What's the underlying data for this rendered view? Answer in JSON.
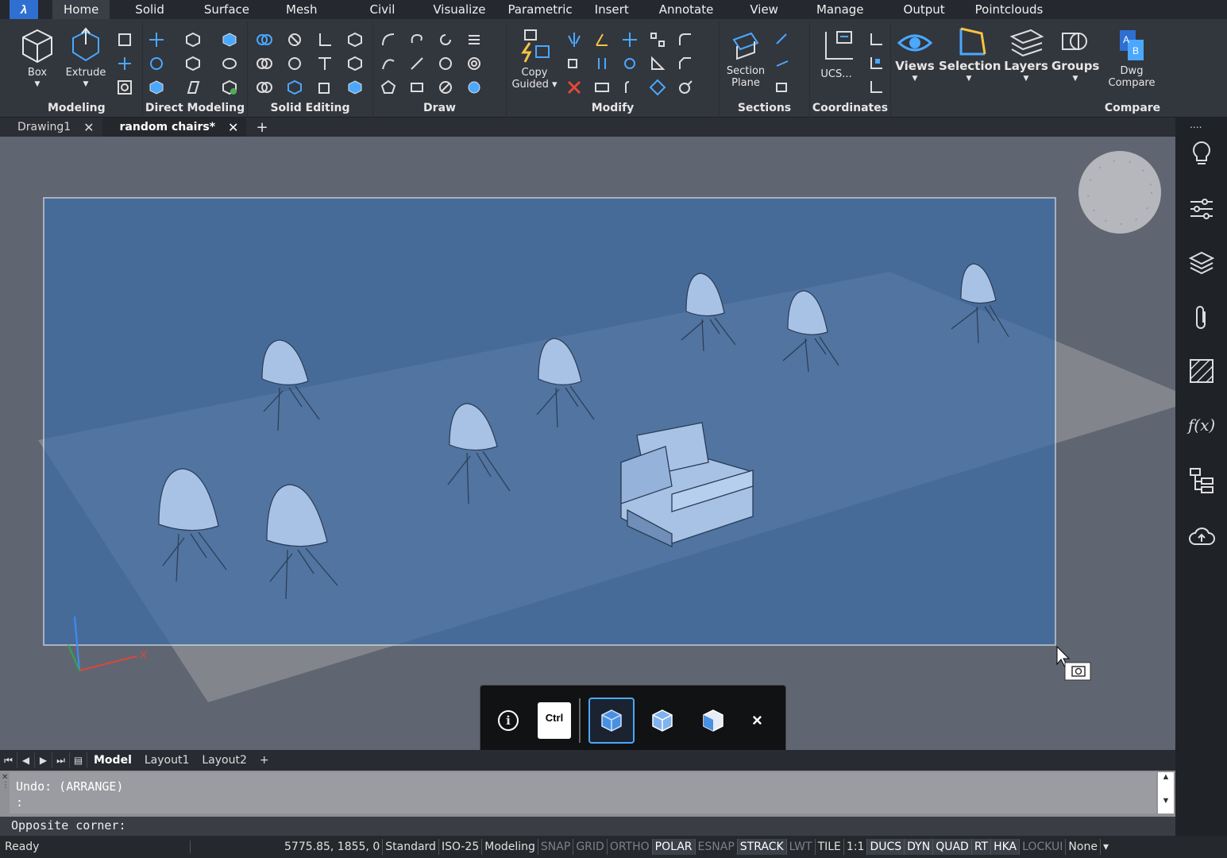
{
  "app": {
    "logo": "λ"
  },
  "menu": {
    "tabs": [
      "Home",
      "Solid",
      "Surface",
      "Mesh",
      "Civil",
      "Visualize",
      "Parametric",
      "Insert",
      "Annotate",
      "View",
      "Manage",
      "Output",
      "Pointclouds"
    ],
    "active": "Home"
  },
  "ribbon": {
    "panels": {
      "modeling": "Modeling",
      "direct_modeling": "Direct Modeling",
      "solid_editing": "Solid Editing",
      "draw": "Draw",
      "modify": "Modify",
      "sections": "Sections",
      "coordinates": "Coordinates",
      "compare": "Compare"
    },
    "buttons": {
      "box": "Box",
      "extrude": "Extrude",
      "copy_guided_1": "Copy",
      "copy_guided_2": "Guided",
      "section_plane_1": "Section",
      "section_plane_2": "Plane",
      "ucs": "UCS...",
      "views": "Views",
      "selection": "Selection",
      "layers": "Layers",
      "groups": "Groups",
      "dwg_compare_1": "Dwg",
      "dwg_compare_2": "Compare"
    }
  },
  "doc_tabs": [
    {
      "label": "Drawing1",
      "active": false
    },
    {
      "label": "random chairs*",
      "active": true
    }
  ],
  "doc_tabs_add": "+",
  "layout_tabs": {
    "model": "Model",
    "layout1": "Layout1",
    "layout2": "Layout2",
    "add": "+"
  },
  "command": {
    "history_line1": "Undo: (ARRANGE)",
    "history_line2": ":",
    "prompt": "Opposite corner:"
  },
  "float_toolbar": {
    "ctrl": "Ctrl",
    "close": "×"
  },
  "axis": {
    "x": "X"
  },
  "status": {
    "ready": "Ready",
    "coords": "5775.85, 1855, 0",
    "items": [
      {
        "label": "Standard",
        "state": "text"
      },
      {
        "label": "ISO-25",
        "state": "text"
      },
      {
        "label": "Modeling",
        "state": "text"
      },
      {
        "label": "SNAP",
        "state": "off"
      },
      {
        "label": "GRID",
        "state": "off"
      },
      {
        "label": "ORTHO",
        "state": "off"
      },
      {
        "label": "POLAR",
        "state": "on"
      },
      {
        "label": "ESNAP",
        "state": "off"
      },
      {
        "label": "STRACK",
        "state": "on"
      },
      {
        "label": "LWT",
        "state": "off"
      },
      {
        "label": "TILE",
        "state": "text"
      },
      {
        "label": "1:1",
        "state": "text"
      },
      {
        "label": "DUCS",
        "state": "on"
      },
      {
        "label": "DYN",
        "state": "on"
      },
      {
        "label": "QUAD",
        "state": "on"
      },
      {
        "label": "RT",
        "state": "on"
      },
      {
        "label": "HKA",
        "state": "on"
      },
      {
        "label": "LOCKUI",
        "state": "off"
      },
      {
        "label": "None",
        "state": "text"
      }
    ]
  },
  "colors": {
    "accent": "#2f6fd1",
    "selection": "#3f6ea8",
    "viewport": "#5f6672"
  },
  "icons": [
    "box-icon",
    "extrude-icon",
    "views-icon",
    "selection-icon",
    "layers-icon",
    "groups-icon",
    "dwg-compare-icon",
    "lightbulb-icon",
    "sliders-icon",
    "stack-icon",
    "paperclip-icon",
    "hatch-icon",
    "function-icon",
    "tree-icon",
    "cloud-upload-icon",
    "navigation-wheel-icon",
    "info-icon",
    "cube-icon"
  ]
}
